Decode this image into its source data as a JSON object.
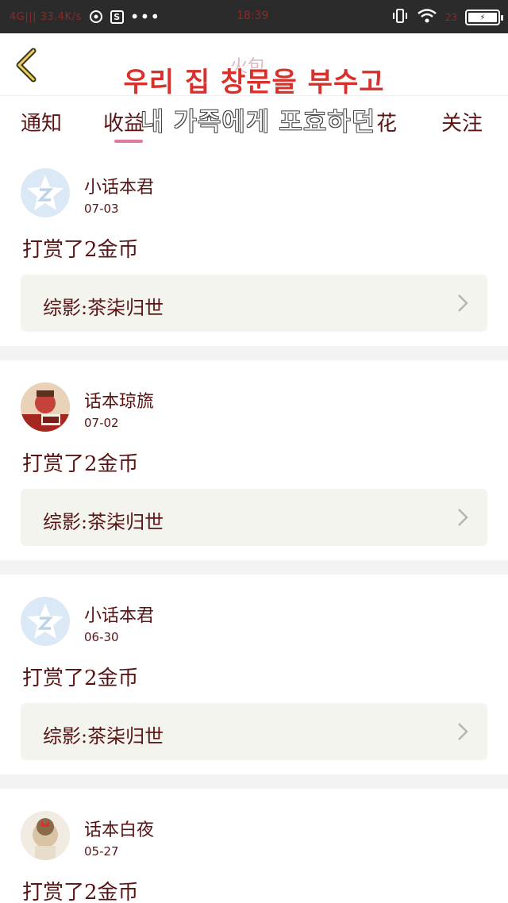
{
  "status_bar": {
    "network": "4G|||  33.4K/s",
    "time": "18:39",
    "battery": "23",
    "icons": [
      "net-eye-icon",
      "s-box-icon",
      "more-dots-icon",
      "vibrate-icon",
      "wifi-icon",
      "battery-icon"
    ]
  },
  "header": {
    "ghost_title": "火包",
    "overlay_title": "우리 집 창문을 부수고",
    "overlay_sub": "내 가족에게 포효하던"
  },
  "tabs": [
    {
      "label": "通知"
    },
    {
      "label": "收益"
    },
    {
      "label": "花"
    },
    {
      "label": "关注"
    }
  ],
  "feed": [
    {
      "user": "小话本君",
      "date": "07-03",
      "action": "打赏了2金币",
      "link": "综影:茶柒归世",
      "avatar": "default"
    },
    {
      "user": "话本琼旒",
      "date": "07-02",
      "action": "打赏了2金币",
      "link": "综影:茶柒归世",
      "avatar": "photo"
    },
    {
      "user": "小话本君",
      "date": "06-30",
      "action": "打赏了2金币",
      "link": "综影:茶柒归世",
      "avatar": "default"
    },
    {
      "user": "话本白夜",
      "date": "05-27",
      "action": "打赏了2金币",
      "link": "",
      "avatar": "photo2"
    }
  ],
  "colors": {
    "text": "#5a1414",
    "overlay_red": "#d9302b",
    "tab_indicator": "#e07aa0",
    "link_box": "#f4f4ef"
  }
}
